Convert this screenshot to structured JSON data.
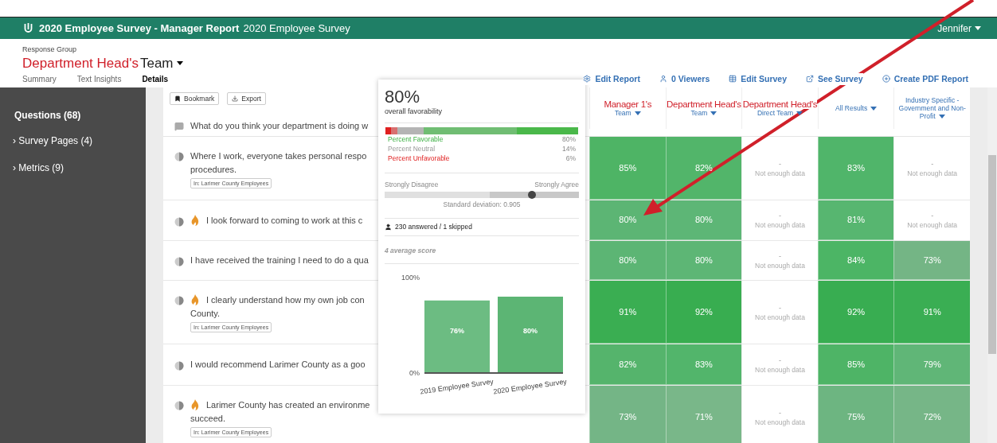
{
  "header": {
    "title": "2020 Employee Survey - Manager Report",
    "subtitle": "2020 Employee Survey",
    "user": "Jennifer"
  },
  "response_group": {
    "label": "Response Group",
    "name": "Department Head's",
    "suffix": "Team"
  },
  "tabs": [
    {
      "label": "Summary",
      "selected": false
    },
    {
      "label": "Text Insights",
      "selected": false
    },
    {
      "label": "Details",
      "selected": true
    }
  ],
  "actions": [
    {
      "kind": "gear",
      "label": "Edit Report"
    },
    {
      "kind": "user",
      "label": "0 Viewers"
    },
    {
      "kind": "table",
      "label": "Edit Survey"
    },
    {
      "kind": "external",
      "label": "See Survey"
    },
    {
      "kind": "download",
      "label": "Create PDF Report"
    }
  ],
  "sidebar": {
    "items": [
      {
        "label": "Questions (68)",
        "kind": "heading"
      },
      {
        "label": "Survey Pages (4)",
        "kind": "group",
        "marker": "›"
      },
      {
        "label": "Metrics (9)",
        "kind": "group",
        "marker": "›"
      }
    ]
  },
  "toolbar": [
    "Bookmark",
    "Export"
  ],
  "columns": [
    {
      "title": "Manager 1's",
      "subtitle": "Team"
    },
    {
      "title": "Department Head's",
      "subtitle": "Team"
    },
    {
      "title": "Department Head's",
      "subtitle": "Direct Team"
    },
    {
      "subtitle": "All Results"
    },
    {
      "subtitle": "Industry Specific - Government and Non-Profit"
    }
  ],
  "rows": [
    {
      "kind": "comment",
      "hot": false,
      "lines": [
        "What do you think your department is doing w"
      ],
      "cells": []
    },
    {
      "kind": "scale",
      "hot": false,
      "lines": [
        "Where I work, everyone takes personal respo",
        "procedures."
      ],
      "tag": "In: Larimer County Employees",
      "cells": [
        {
          "text": "85%",
          "color": "#4eb465"
        },
        {
          "text": "82%",
          "color": "#52b56a"
        },
        {
          "kind": "nodata",
          "dash": "-",
          "note": "Not enough data"
        },
        {
          "text": "83%",
          "color": "#50b56a"
        },
        {
          "kind": "nodata",
          "dash": "-",
          "note": "Not enough data"
        }
      ]
    },
    {
      "kind": "scale",
      "hot": true,
      "lines": [
        "I look forward to coming to work at this c"
      ],
      "cells": [
        {
          "text": "80%",
          "color": "#5cb574"
        },
        {
          "text": "80%",
          "color": "#5db676"
        },
        {
          "kind": "nodata",
          "dash": "-",
          "note": "Not enough data"
        },
        {
          "text": "81%",
          "color": "#57b670"
        },
        {
          "kind": "nodata",
          "dash": "-",
          "note": "Not enough data"
        }
      ]
    },
    {
      "kind": "scale",
      "hot": false,
      "lines": [
        "I have received the training I need to do a qua"
      ],
      "cells": [
        {
          "text": "80%",
          "color": "#5cb574"
        },
        {
          "text": "80%",
          "color": "#5db675"
        },
        {
          "kind": "nodata",
          "dash": "-",
          "note": "Not enough data"
        },
        {
          "text": "84%",
          "color": "#4cb565"
        },
        {
          "text": "73%",
          "color": "#74b585"
        }
      ]
    },
    {
      "kind": "scale",
      "hot": true,
      "lines": [
        "I clearly understand how my own job con",
        "County."
      ],
      "tag": "In: Larimer County Employees",
      "cells": [
        {
          "text": "91%",
          "color": "#3aae52"
        },
        {
          "text": "92%",
          "color": "#38ad50"
        },
        {
          "kind": "nodata",
          "dash": "-",
          "note": "Not enough data"
        },
        {
          "text": "92%",
          "color": "#38ad51"
        },
        {
          "text": "91%",
          "color": "#3aae53"
        }
      ]
    },
    {
      "kind": "scale",
      "hot": false,
      "lines": [
        "I would recommend Larimer County as a goo"
      ],
      "cells": [
        {
          "text": "82%",
          "color": "#55b46c"
        },
        {
          "text": "83%",
          "color": "#52b56b"
        },
        {
          "kind": "nodata",
          "dash": "-",
          "note": "Not enough data"
        },
        {
          "text": "85%",
          "color": "#4eb466"
        },
        {
          "text": "79%",
          "color": "#60b677"
        }
      ]
    },
    {
      "kind": "scale",
      "hot": true,
      "lines": [
        "Larimer County has created an environme",
        "succeed."
      ],
      "tag": "In: Larimer County Employees",
      "cells": [
        {
          "text": "73%",
          "color": "#74b586"
        },
        {
          "text": "71%",
          "color": "#79b789"
        },
        {
          "kind": "nodata",
          "dash": "-",
          "note": "Not enough data"
        },
        {
          "text": "75%",
          "color": "#6db581"
        },
        {
          "text": "72%",
          "color": "#76b687"
        }
      ]
    }
  ],
  "popup": {
    "value": "80%",
    "caption": "overall favorability",
    "bar": [
      {
        "level": 0.03,
        "color": "#e02020"
      },
      {
        "level": 0.03,
        "color": "#d87070"
      },
      {
        "level": 0.14,
        "color": "#b4b4b4"
      },
      {
        "level": 0.48,
        "color": "#70bd73"
      },
      {
        "level": 0.32,
        "color": "#4ab84a"
      }
    ],
    "legend": [
      {
        "kind": "favorable",
        "label": "Percent Favorable",
        "value": "80%"
      },
      {
        "kind": "neutral",
        "label": "Percent Neutral",
        "value": "14%"
      },
      {
        "kind": "unfavorable",
        "label": "Percent Unfavorable",
        "value": "6%"
      }
    ],
    "scale": {
      "low": "Strongly Disagree",
      "high": "Strongly Agree",
      "level": 0.76,
      "deviation": "Standard deviation: 0.905"
    },
    "answered": "230 answered / 1 skipped",
    "average": "4 average score",
    "chart_data": {
      "type": "bar",
      "categories": [
        "2019 Employee Survey",
        "2020 Employee Survey"
      ],
      "series": [
        {
          "color": "#5cb574",
          "values": [
            76,
            80
          ]
        }
      ],
      "ylim": [
        0,
        100
      ],
      "yticks": [
        {
          "value": 0,
          "label": "0%"
        },
        {
          "value": 100,
          "label": "100%"
        }
      ],
      "value_labels": [
        "76%",
        "80%"
      ]
    }
  }
}
